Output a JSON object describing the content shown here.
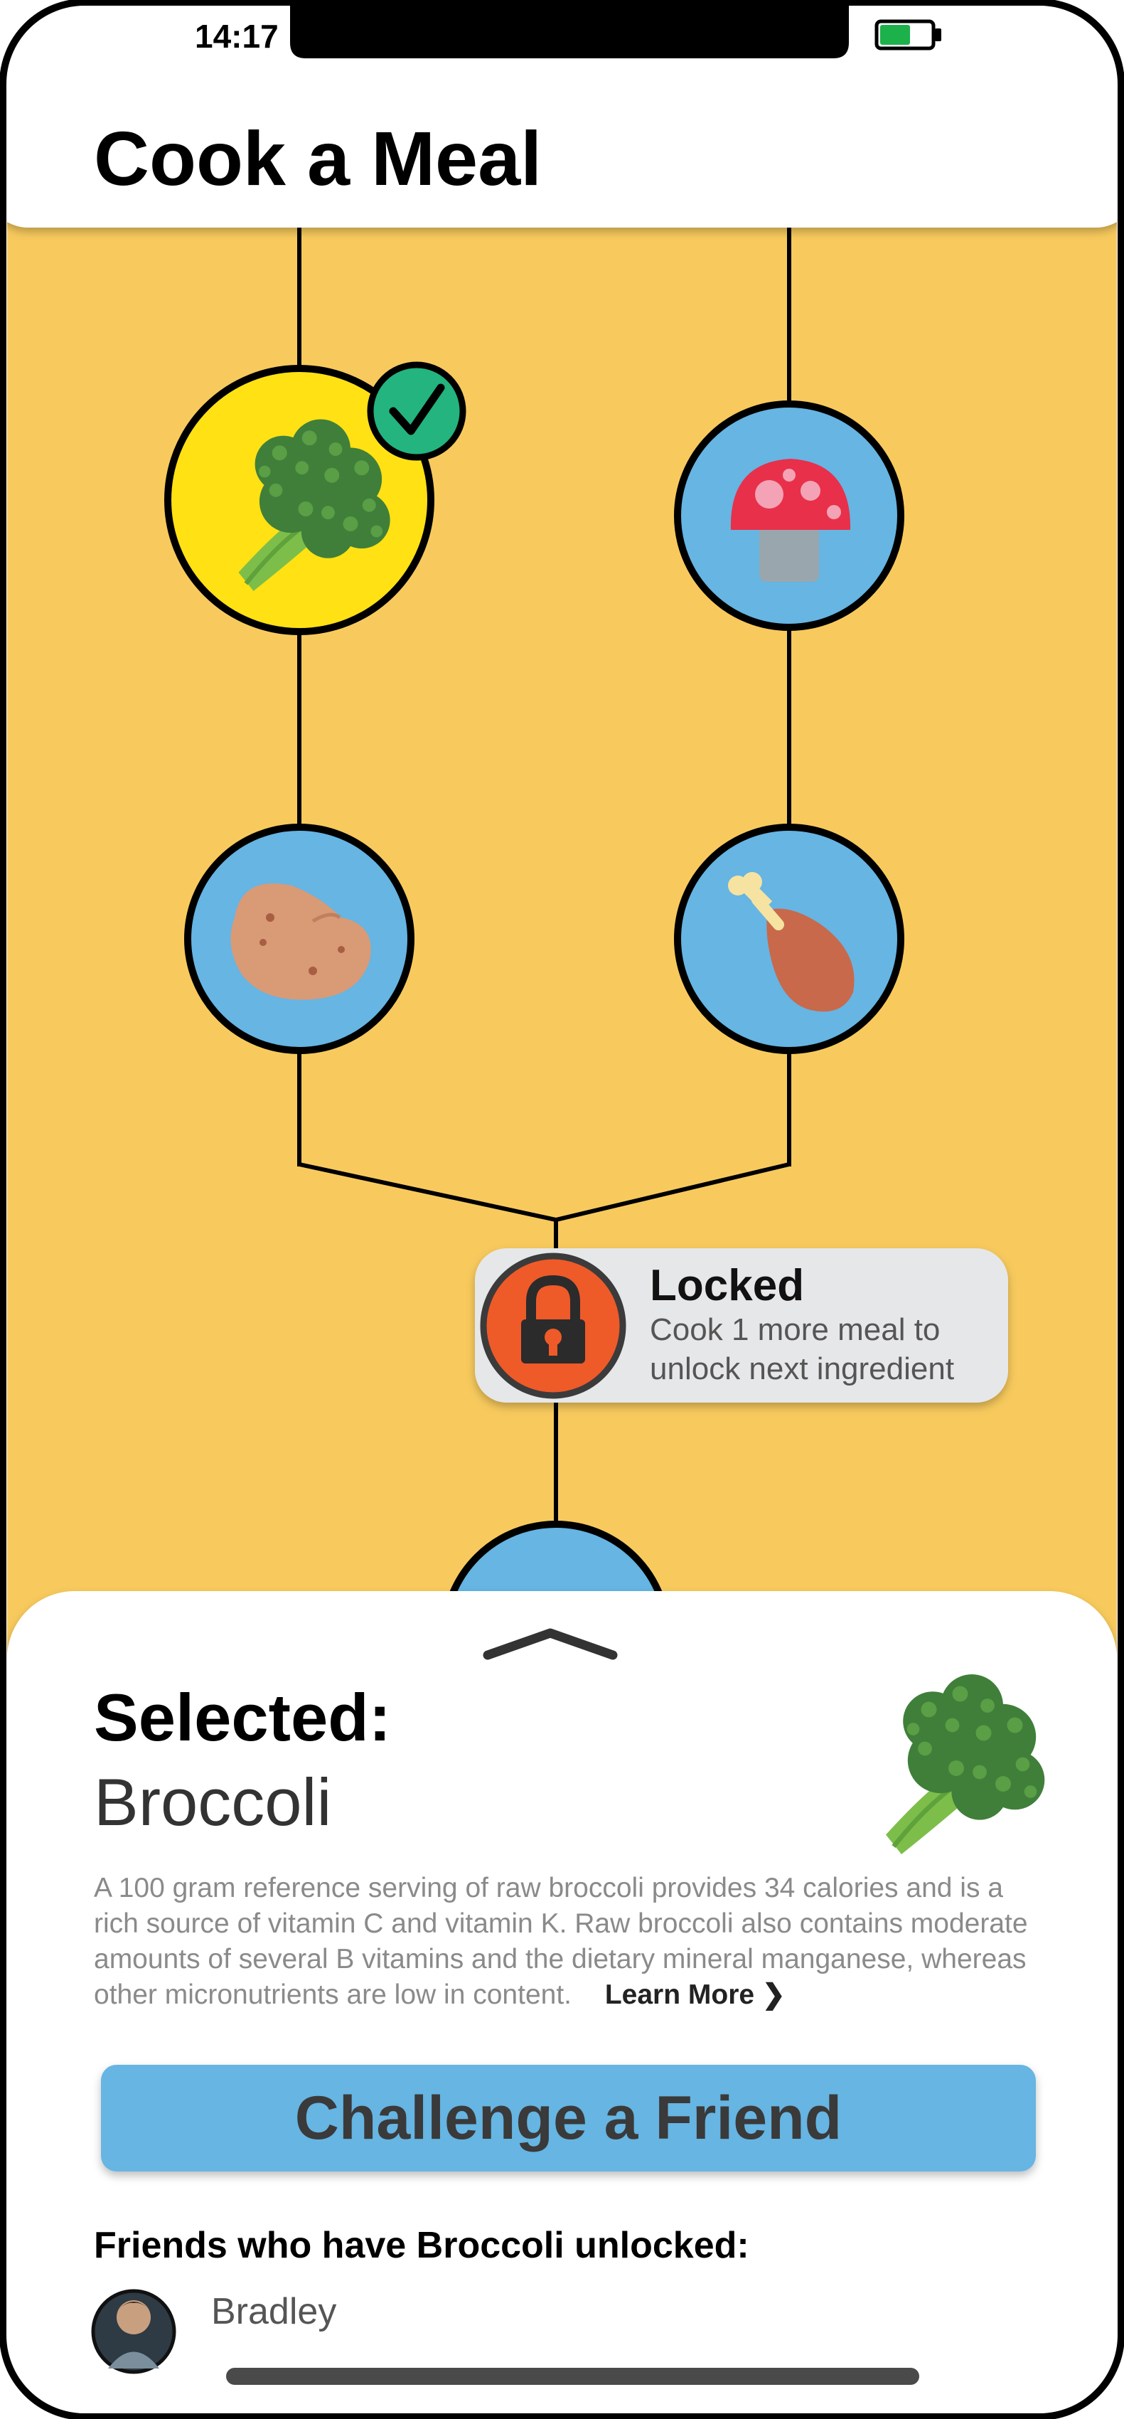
{
  "status_bar": {
    "time": "14:17",
    "battery_level": 0.6
  },
  "header": {
    "title": "Cook a Meal"
  },
  "skill_tree": {
    "nodes": [
      {
        "name": "broccoli",
        "icon": "broccoli-icon",
        "state": "completed"
      },
      {
        "name": "mushroom",
        "icon": "mushroom-icon",
        "state": "available"
      },
      {
        "name": "potato",
        "icon": "potato-icon",
        "state": "available"
      },
      {
        "name": "chicken-leg",
        "icon": "chicken-leg-icon",
        "state": "available"
      },
      {
        "name": "next-ingredient",
        "icon": "broccoli-icon",
        "state": "locked"
      }
    ],
    "locked_tooltip": {
      "title": "Locked",
      "line1": "Cook 1 more meal to",
      "line2": "unlock next ingredient"
    }
  },
  "sheet": {
    "selected_label": "Selected:",
    "selected_item": "Broccoli",
    "description_lines": [
      "A 100 gram reference serving of raw broccoli provides 34 calories and is a",
      "rich source of vitamin C and vitamin K. Raw broccoli also contains moderate",
      "amounts of several B vitamins and the dietary mineral manganese, whereas",
      "other micronutrients are low in content."
    ],
    "learn_more": "Learn More",
    "challenge_button": "Challenge a Friend",
    "friends_heading": "Friends who have Broccoli unlocked:",
    "friends": [
      {
        "name": "Bradley"
      }
    ]
  },
  "colors": {
    "background": "#F8CA5D",
    "node_blue": "#66B5E3",
    "node_selected": "#FFE114",
    "check_green": "#23B47F",
    "lock_orange": "#EF5A29",
    "button_blue": "#66B5E3",
    "tooltip_bg": "#E6E7E9"
  }
}
